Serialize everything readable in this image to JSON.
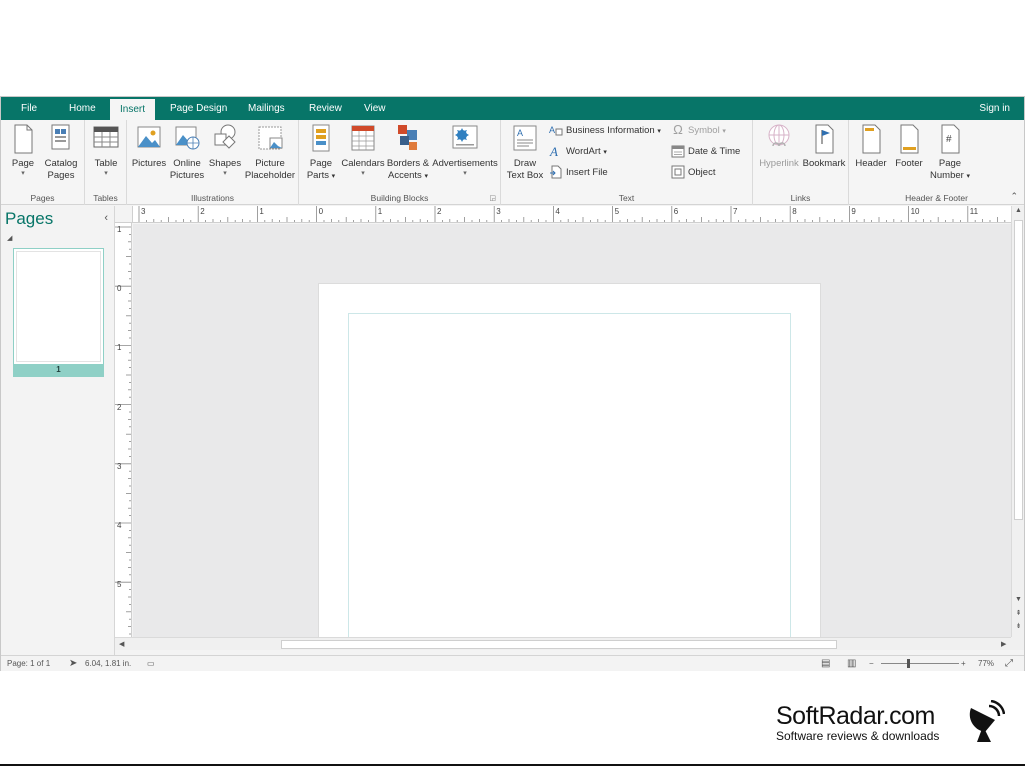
{
  "tabs": [
    "File",
    "Home",
    "Insert",
    "Page Design",
    "Mailings",
    "Review",
    "View"
  ],
  "active_tab": "Insert",
  "signin": "Sign in",
  "ribbon": {
    "pages": {
      "label": "Pages",
      "page": "Page",
      "catalog1": "Catalog",
      "catalog2": "Pages"
    },
    "tables": {
      "label": "Tables",
      "table": "Table"
    },
    "illustrations": {
      "label": "Illustrations",
      "pictures": "Pictures",
      "online1": "Online",
      "online2": "Pictures",
      "shapes": "Shapes",
      "placeholder1": "Picture",
      "placeholder2": "Placeholder"
    },
    "building_blocks": {
      "label": "Building Blocks",
      "parts1": "Page",
      "parts2": "Parts",
      "calendars": "Calendars",
      "borders1": "Borders &",
      "borders2": "Accents",
      "ads": "Advertisements"
    },
    "text": {
      "label": "Text",
      "draw1": "Draw",
      "draw2": "Text Box",
      "business": "Business Information",
      "wordart": "WordArt",
      "insertfile": "Insert File",
      "symbol": "Symbol",
      "datetime": "Date & Time",
      "object": "Object"
    },
    "links": {
      "label": "Links",
      "hyperlink": "Hyperlink",
      "bookmark": "Bookmark"
    },
    "header_footer": {
      "label": "Header & Footer",
      "header": "Header",
      "footer": "Footer",
      "pagenum1": "Page",
      "pagenum2": "Number"
    }
  },
  "pages_pane": {
    "title": "Pages",
    "thumb_number": "1"
  },
  "hruler_numbers": [
    "3",
    "2",
    "1",
    "0",
    "1",
    "2",
    "3",
    "4",
    "5",
    "6",
    "7",
    "8",
    "9",
    "10",
    "11"
  ],
  "vruler_numbers": [
    "1",
    "0",
    "1",
    "2",
    "3",
    "4",
    "5"
  ],
  "status": {
    "page": "Page: 1 of 1",
    "position": "6.04, 1.81 in.",
    "zoom": "77%"
  },
  "watermark": {
    "title": "SoftRadar.com",
    "subtitle": "Software reviews & downloads"
  },
  "colors": {
    "accent": "#077568",
    "thumb_highlight": "#8fd0c6"
  }
}
